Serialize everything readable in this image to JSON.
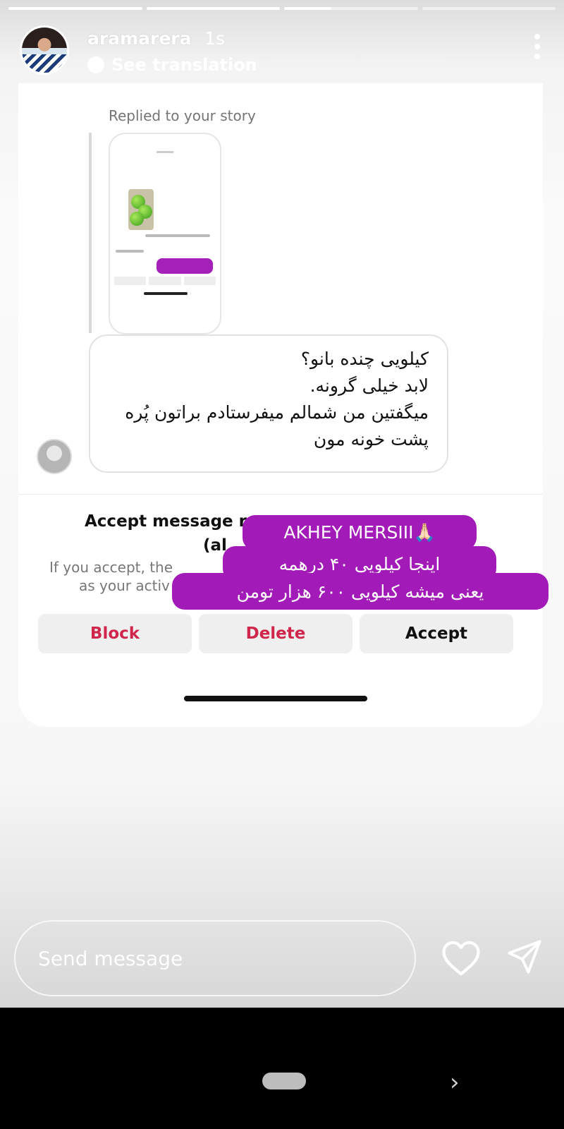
{
  "story": {
    "progress": [
      1.0,
      1.0,
      0.35,
      0.0
    ],
    "username": "aramarera",
    "time": "1s",
    "see_translation": "See translation"
  },
  "dm": {
    "replied_label": "Replied to your story",
    "message_lines": [
      "کیلویی چنده بانو؟",
      "لابد خیلی گرونه.",
      "میگفتین من شمالم میفرستادم براتون پُره",
      "پشت خونه مون"
    ],
    "request_title_1": "Accept message re",
    "request_title_2": "(al",
    "request_desc_1": "If you accept, the",
    "request_desc_2": "as your activ",
    "buttons": {
      "block": "Block",
      "delete": "Delete",
      "accept": "Accept"
    }
  },
  "stickers": {
    "line1": "AKHEY MERSIII🙏🏻",
    "line2": "اینجا کیلویی ۴۰ درهمه",
    "line3": "یعنی میشه کیلویی ۶۰۰ هزار تومن"
  },
  "footer": {
    "send_placeholder": "Send message"
  },
  "colors": {
    "sticker_purple": "#a21ab7",
    "danger_red": "#d0264b"
  }
}
